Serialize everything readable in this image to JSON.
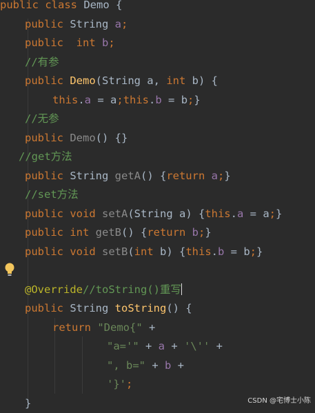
{
  "editor": {
    "lines": [
      [
        [
          "public ",
          "kw"
        ],
        [
          "class ",
          "kw"
        ],
        [
          "Demo {",
          "txt"
        ]
      ],
      [
        [
          "public ",
          "kw"
        ],
        [
          "String ",
          "txt"
        ],
        [
          "a",
          "fld"
        ],
        [
          ";",
          "kw"
        ]
      ],
      [
        [
          "public  ",
          "kw"
        ],
        [
          "int ",
          "kw"
        ],
        [
          "b",
          "fld"
        ],
        [
          ";",
          "kw"
        ]
      ],
      [
        [
          "//有参",
          "cmt"
        ]
      ],
      [
        [
          "public ",
          "kw"
        ],
        [
          "Demo",
          "fn"
        ],
        [
          "(String a, ",
          "txt"
        ],
        [
          "int ",
          "kw"
        ],
        [
          "b) {",
          "txt"
        ]
      ],
      [
        [
          "this",
          "kw"
        ],
        [
          ".",
          "txt"
        ],
        [
          "a",
          "fld"
        ],
        [
          " = a",
          "txt"
        ],
        [
          ";",
          "kw"
        ],
        [
          "this",
          "kw"
        ],
        [
          ".",
          "txt"
        ],
        [
          "b",
          "fld"
        ],
        [
          " = b",
          "txt"
        ],
        [
          ";",
          "kw"
        ],
        [
          "}",
          "txt"
        ]
      ],
      [
        [
          "//无参",
          "cmt"
        ]
      ],
      [
        [
          "public ",
          "kw"
        ],
        [
          "Demo",
          "unused"
        ],
        [
          "() {}",
          "txt"
        ]
      ],
      [
        [
          "//get方法",
          "cmt"
        ]
      ],
      [
        [
          "public ",
          "kw"
        ],
        [
          "String ",
          "txt"
        ],
        [
          "getA",
          "unused"
        ],
        [
          "() {",
          "txt"
        ],
        [
          "return ",
          "kw"
        ],
        [
          "a",
          "fld"
        ],
        [
          ";",
          "kw"
        ],
        [
          "}",
          "txt"
        ]
      ],
      [
        [
          "//set方法",
          "cmt"
        ]
      ],
      [
        [
          "public ",
          "kw"
        ],
        [
          "void ",
          "kw"
        ],
        [
          "setA",
          "unused"
        ],
        [
          "(String a) {",
          "txt"
        ],
        [
          "this",
          "kw"
        ],
        [
          ".",
          "txt"
        ],
        [
          "a",
          "fld"
        ],
        [
          " = a",
          "txt"
        ],
        [
          ";",
          "kw"
        ],
        [
          "}",
          "txt"
        ]
      ],
      [
        [
          "public ",
          "kw"
        ],
        [
          "int ",
          "kw"
        ],
        [
          "getB",
          "unused"
        ],
        [
          "() {",
          "txt"
        ],
        [
          "return ",
          "kw"
        ],
        [
          "b",
          "fld"
        ],
        [
          ";",
          "kw"
        ],
        [
          "}",
          "txt"
        ]
      ],
      [
        [
          "public ",
          "kw"
        ],
        [
          "void ",
          "kw"
        ],
        [
          "setB",
          "unused"
        ],
        [
          "(",
          "txt"
        ],
        [
          "int ",
          "kw"
        ],
        [
          "b) {",
          "txt"
        ],
        [
          "this",
          "kw"
        ],
        [
          ".",
          "txt"
        ],
        [
          "b",
          "fld"
        ],
        [
          " = b",
          "txt"
        ],
        [
          ";",
          "kw"
        ],
        [
          "}",
          "txt"
        ]
      ],
      [],
      [
        [
          "@Override",
          "ann"
        ],
        [
          "//toString()重写",
          "cmt"
        ]
      ],
      [
        [
          "public ",
          "kw"
        ],
        [
          "String ",
          "txt"
        ],
        [
          "toString",
          "fn"
        ],
        [
          "() {",
          "txt"
        ]
      ],
      [
        [
          "return ",
          "kw"
        ],
        [
          "\"Demo{\"",
          "str"
        ],
        [
          " +",
          "txt"
        ]
      ],
      [
        [
          "\"a='\"",
          "str"
        ],
        [
          " + ",
          "txt"
        ],
        [
          "a",
          "fld"
        ],
        [
          " + ",
          "txt"
        ],
        [
          "'\\''",
          "str"
        ],
        [
          " +",
          "txt"
        ]
      ],
      [
        [
          "\", b=\"",
          "str"
        ],
        [
          " + ",
          "txt"
        ],
        [
          "b",
          "fld"
        ],
        [
          " +",
          "txt"
        ]
      ],
      [
        [
          "'}'",
          "str"
        ],
        [
          ";",
          "kw"
        ]
      ],
      [
        [
          "}",
          "txt"
        ]
      ]
    ]
  },
  "watermark": "CSDN @宅博士小陈"
}
